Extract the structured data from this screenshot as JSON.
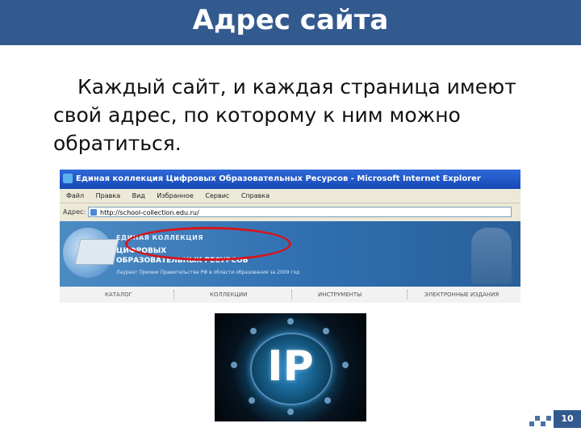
{
  "slide": {
    "title": "Адрес сайта",
    "paragraph_line1": "Каждый сайт, и каждая страница имеют",
    "paragraph_line2": "свой адрес, по которому к ним можно",
    "paragraph_line3": "обратиться.",
    "page_number": "10",
    "colors": {
      "header": "#335a8e",
      "highlight_oval": "#d8141a"
    }
  },
  "browser": {
    "window_title": "Единая коллекция Цифровых Образовательных Ресурсов - Microsoft Internet Explorer",
    "menu": [
      "Файл",
      "Правка",
      "Вид",
      "Избранное",
      "Сервис",
      "Справка"
    ],
    "address_label": "Адрес:",
    "address_value": "http://school-collection.edu.ru/",
    "site": {
      "line1": "ЕДИНАЯ КОЛЛЕКЦИЯ",
      "line2": "ЦИФРОВЫХ",
      "line3": "ОБРАЗОВАТЕЛЬНЫХ РЕСУРСОВ",
      "line4": "Лауреат Премии Правительства РФ в области образования за 2009 год",
      "nav": [
        "КАТАЛОГ",
        "КОЛЛЕКЦИИ",
        "ИНСТРУМЕНТЫ",
        "ЭЛЕКТРОННЫЕ ИЗДАНИЯ"
      ]
    }
  },
  "image": {
    "label": "IP"
  }
}
